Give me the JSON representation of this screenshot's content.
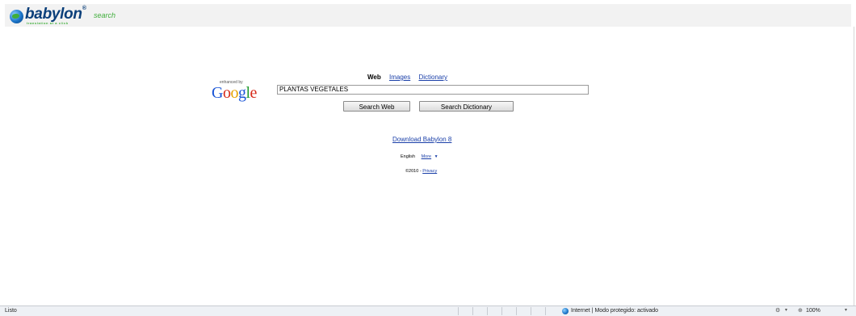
{
  "header": {
    "logo_text": "babylon",
    "logo_reg": "®",
    "logo_suffix": "search",
    "logo_tagline": "translation at a click"
  },
  "search": {
    "tabs": [
      {
        "label": "Web",
        "active": true
      },
      {
        "label": "Images",
        "active": false
      },
      {
        "label": "Dictionary",
        "active": false
      }
    ],
    "enhanced_by": "enhanced by",
    "google_letters": [
      "G",
      "o",
      "o",
      "g",
      "l",
      "e"
    ],
    "query_value": "PLANTAS VEGETALES",
    "search_web_label": "Search Web",
    "search_dictionary_label": "Search Dictionary"
  },
  "links": {
    "download": "Download Babylon 8",
    "language": "English",
    "more": "More",
    "copyright": "©2010 - ",
    "privacy": "Privacy"
  },
  "status_bar": {
    "status_text": "Listo",
    "zone_text": "Internet | Modo protegido: activado",
    "zoom": "100%"
  },
  "icons": {
    "logo": "babylon-globe-icon",
    "zone": "internet-globe-icon",
    "tools": "tools-icon",
    "zoom": "zoom-icon",
    "more_caret": "caret-down-icon"
  },
  "colors": {
    "link": "#1a3fa8",
    "brand_blue": "#0b3f7a",
    "brand_green": "#3fae3a",
    "header_bg": "#f2f2f2",
    "status_bg": "#eef1f5"
  }
}
